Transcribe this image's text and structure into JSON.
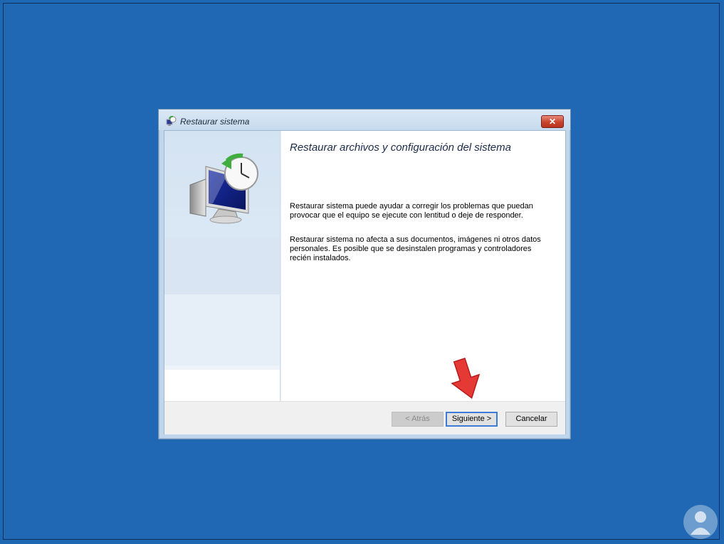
{
  "window": {
    "title": "Restaurar sistema",
    "close_label": "✕"
  },
  "content": {
    "heading": "Restaurar archivos y configuración del sistema",
    "paragraph1": "Restaurar sistema puede ayudar a corregir los problemas que puedan provocar que el equipo se ejecute con lentitud o deje de responder.",
    "paragraph2": "Restaurar sistema no afecta a sus documentos, imágenes ni otros datos personales. Es posible que se desinstalen programas y controladores recién instalados."
  },
  "footer": {
    "back_label": "< Atrás",
    "next_label": "Siguiente >",
    "cancel_label": "Cancelar"
  },
  "icons": {
    "title": "system-restore-icon",
    "hero": "system-restore-monitor-clock-icon",
    "annotation": "red-arrow-down-icon",
    "watermark": "watermark-logo"
  },
  "colors": {
    "desktop": "#1e67b3",
    "close_button": "#c8432d",
    "arrow": "#e53935",
    "default_button_border": "#3d7bd6"
  }
}
